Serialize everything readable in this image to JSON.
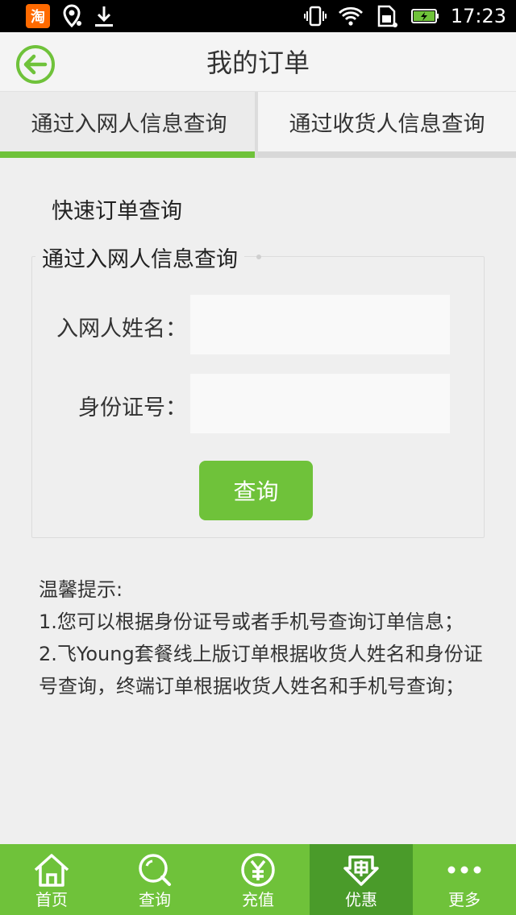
{
  "statusbar": {
    "app_badge": "淘",
    "time": "17:23"
  },
  "header": {
    "title": "我的订单"
  },
  "tabs": [
    {
      "label": "通过入网人信息查询",
      "active": true
    },
    {
      "label": "通过收货人信息查询",
      "active": false
    }
  ],
  "main": {
    "section_title": "快速订单查询",
    "form": {
      "legend": "通过入网人信息查询",
      "name_label": "入网人姓名：",
      "name_value": "",
      "id_label": "身份证号：",
      "id_value": "",
      "submit_label": "查询"
    },
    "tips": {
      "title": "温馨提示:",
      "line1": "1.您可以根据身份证号或者手机号查询订单信息；",
      "line2": "2.飞Young套餐线上版订单根据收货人姓名和身份证号查询，终端订单根据收货人姓名和手机号查询；"
    }
  },
  "bottomnav": {
    "items": [
      {
        "label": "首页",
        "icon": "home-icon"
      },
      {
        "label": "查询",
        "icon": "search-icon"
      },
      {
        "label": "充值",
        "icon": "yuan-icon"
      },
      {
        "label": "优惠",
        "icon": "discount-icon"
      },
      {
        "label": "更多",
        "icon": "more-icon"
      }
    ],
    "active_index": 3
  },
  "colors": {
    "accent": "#6fc23a",
    "accent_dark": "#4a9b2a",
    "background": "#efefef"
  }
}
